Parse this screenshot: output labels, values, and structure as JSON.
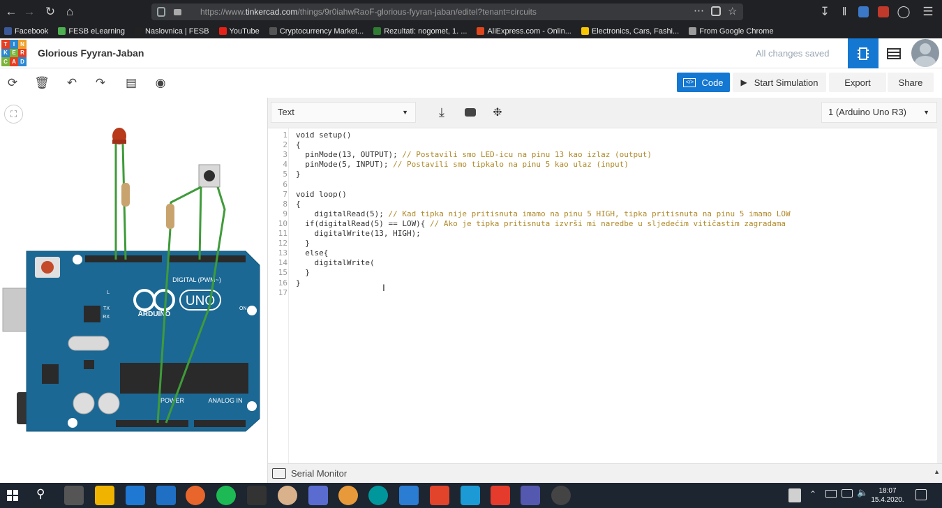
{
  "browser": {
    "url_prefix": "https://www.",
    "url_domain": "tinkercad.com",
    "url_path": "/things/9r0iahwRaoF-glorious-fyyran-jaban/editel?tenant=circuits",
    "bookmarks": [
      {
        "label": "Facebook",
        "color": "#3b5998"
      },
      {
        "label": "FESB eLearning",
        "color": "#4caf50"
      },
      {
        "label": "Naslovnica | FESB",
        "color": "#222"
      },
      {
        "label": "YouTube",
        "color": "#e62117"
      },
      {
        "label": "Cryptocurrency Market...",
        "color": "#555"
      },
      {
        "label": "Rezultati: nogomet, 1. ...",
        "color": "#2e7d32"
      },
      {
        "label": "AliExpress.com - Onlin...",
        "color": "#e0461c"
      },
      {
        "label": "Electronics, Cars, Fashi...",
        "color": "#f7c600"
      },
      {
        "label": "From Google Chrome",
        "color": "#9c9c9c"
      }
    ]
  },
  "header": {
    "logo_letters": [
      "TIN",
      "KER",
      "CAD"
    ],
    "title": "Glorious Fyyran-Jaban",
    "save_status": "All changes saved"
  },
  "toolbar": {
    "code_label": "Code",
    "simulate_label": "Start Simulation",
    "export_label": "Export",
    "share_label": "Share"
  },
  "code_panel": {
    "mode": "Text",
    "board": "1 (Arduino Uno R3)",
    "serial_monitor_label": "Serial Monitor",
    "lines": [
      {
        "n": "1",
        "code": "void setup()",
        "comment": ""
      },
      {
        "n": "2",
        "code": "{",
        "comment": ""
      },
      {
        "n": "3",
        "code": "  pinMode(13, OUTPUT); ",
        "comment": "// Postavili smo LED-icu na pinu 13 kao izlaz (output)"
      },
      {
        "n": "4",
        "code": "  pinMode(5, INPUT); ",
        "comment": "// Postavili smo tipkalo na pinu 5 kao ulaz (input)"
      },
      {
        "n": "5",
        "code": "}",
        "comment": ""
      },
      {
        "n": "6",
        "code": "",
        "comment": ""
      },
      {
        "n": "7",
        "code": "void loop()",
        "comment": ""
      },
      {
        "n": "8",
        "code": "{",
        "comment": ""
      },
      {
        "n": "9",
        "code": "    digitalRead(5); ",
        "comment": "// Kad tipka nije pritisnuta imamo na pinu 5 HIGH, tipka pritisnuta na pinu 5 imamo LOW"
      },
      {
        "n": "10",
        "code": "  if(digitalRead(5) == LOW){ ",
        "comment": "// Ako je tipka pritisnuta izvrši mi naredbe u sljedećim vitičastim zagradama"
      },
      {
        "n": "11",
        "code": "    digitalWrite(13, HIGH);",
        "comment": ""
      },
      {
        "n": "12",
        "code": "  }",
        "comment": ""
      },
      {
        "n": "13",
        "code": "  else{",
        "comment": ""
      },
      {
        "n": "14",
        "code": "    digitalWrite(",
        "comment": ""
      },
      {
        "n": "15",
        "code": "  }",
        "comment": ""
      },
      {
        "n": "16",
        "code": "}",
        "comment": ""
      },
      {
        "n": "17",
        "code": "",
        "comment": ""
      }
    ]
  },
  "board": {
    "brand": "ARDUINO",
    "model": "UNO",
    "digital_label": "DIGITAL (PWM~)",
    "power_label": "POWER",
    "analog_label": "ANALOG IN",
    "led_labels": [
      "L",
      "TX",
      "RX"
    ],
    "on_label": "ON"
  },
  "taskbar": {
    "time": "18:07",
    "date": "15.4.2020."
  }
}
